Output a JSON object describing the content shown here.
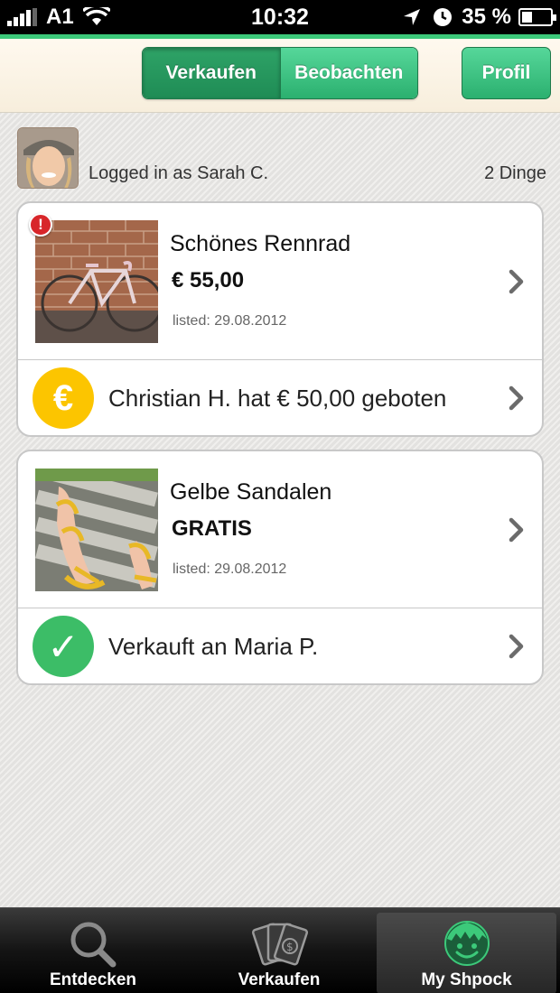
{
  "status_bar": {
    "carrier": "A1",
    "time": "10:32",
    "battery_text": "35 %",
    "battery_level": 0.35
  },
  "header": {
    "segments": [
      {
        "label": "Verkaufen",
        "active": true
      },
      {
        "label": "Beobachten",
        "active": false
      }
    ],
    "profile_label": "Profil"
  },
  "user": {
    "logged_in_text": "Logged in as Sarah C.",
    "items_count": "2 Dinge"
  },
  "listings": [
    {
      "title": "Schönes Rennrad",
      "price": "€ 55,00",
      "listed": "listed: 29.08.2012",
      "alert": "!",
      "sub_icon": "euro-icon",
      "sub_icon_glyph": "€",
      "sub_icon_color": "#fcc500",
      "sub_text": "Christian H. hat € 50,00 geboten"
    },
    {
      "title": "Gelbe Sandalen",
      "price": "GRATIS",
      "listed": "listed: 29.08.2012",
      "sub_icon": "checkmark-icon",
      "sub_icon_glyph": "✓",
      "sub_icon_color": "#3cbd67",
      "sub_text": "Verkauft an Maria P."
    }
  ],
  "tabbar": {
    "tabs": [
      {
        "label": "Entdecken",
        "icon": "magnifier-icon",
        "active": false
      },
      {
        "label": "Verkaufen",
        "icon": "money-notes-icon",
        "active": false
      },
      {
        "label": "My Shpock",
        "icon": "smiley-icon",
        "active": true
      }
    ]
  },
  "colors": {
    "accent_green": "#3cc97a",
    "button_green": "#2bb06f",
    "euro_yellow": "#fcc500",
    "check_green": "#3cbd67",
    "alert_red": "#d8262a"
  }
}
